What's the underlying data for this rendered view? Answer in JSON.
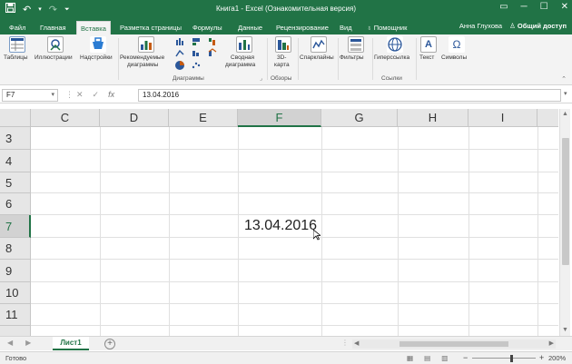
{
  "window": {
    "title": "Книга1 - Excel (Ознакомительная версия)",
    "save_icon": "save-icon",
    "undo_icon": "undo-icon",
    "redo_icon": "redo-icon",
    "qat_more_icon": "qat-more-icon"
  },
  "tabs": [
    {
      "label": "Файл"
    },
    {
      "label": "Главная"
    },
    {
      "label": "Вставка"
    },
    {
      "label": "Разметка страницы"
    },
    {
      "label": "Формулы"
    },
    {
      "label": "Данные"
    },
    {
      "label": "Рецензирование"
    },
    {
      "label": "Вид"
    },
    {
      "label": "Помощник"
    }
  ],
  "user": {
    "name": "Анна Глухова",
    "share": "Общий доступ"
  },
  "ribbon": {
    "tables": "Таблицы",
    "illustrations": "Иллюстрации",
    "addins": "Надстройки",
    "recommended_charts_1": "Рекомендуемые",
    "recommended_charts_2": "диаграммы",
    "pivot_chart_1": "Сводная",
    "pivot_chart_2": "диаграмма",
    "map3d_1": "3D-",
    "map3d_2": "карта",
    "sparklines": "Спарклайны",
    "filters": "Фильтры",
    "hyperlink": "Гиперссылка",
    "text": "Текст",
    "symbols": "Символы",
    "group_charts": "Диаграммы",
    "group_tours": "Обзоры",
    "group_links": "Ссылки"
  },
  "formula_bar": {
    "name_box": "F7",
    "value": "13.04.2016"
  },
  "grid": {
    "columns": [
      "C",
      "D",
      "E",
      "F",
      "G",
      "H",
      "I"
    ],
    "rows": [
      "3",
      "4",
      "5",
      "6",
      "7",
      "8",
      "9",
      "10",
      "11"
    ],
    "selected_column": "F",
    "selected_row": "7",
    "cell_value": "13.04.2016"
  },
  "sheets": {
    "active": "Лист1"
  },
  "status": {
    "ready": "Готово",
    "zoom": "200%"
  }
}
